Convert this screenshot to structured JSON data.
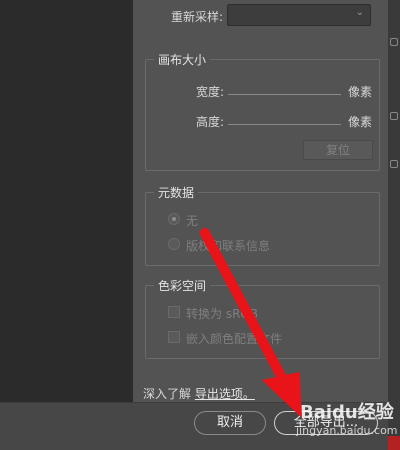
{
  "resample": {
    "label": "重新采样:",
    "value": ""
  },
  "canvas_size": {
    "legend": "画布大小",
    "width_label": "宽度:",
    "width_unit": "像素",
    "height_label": "高度:",
    "height_unit": "像素",
    "reset_label": "复位"
  },
  "metadata": {
    "legend": "元数据",
    "options": [
      "无",
      "版权和联系信息"
    ],
    "selected": "无"
  },
  "color_space": {
    "legend": "色彩空间",
    "options": [
      "转换为 sRGB",
      "嵌入颜色配置文件"
    ]
  },
  "footer": {
    "learn_prefix": "深入了解",
    "learn_link": "导出选项。",
    "cancel_label": "取消",
    "export_label": "全部导出..."
  },
  "watermark": {
    "brand": "Baidu经验",
    "site": "jingyan.baidu.com"
  },
  "colors": {
    "arrow": "#e8141a",
    "panel": "#535353",
    "preview": "#2b2b2b"
  }
}
